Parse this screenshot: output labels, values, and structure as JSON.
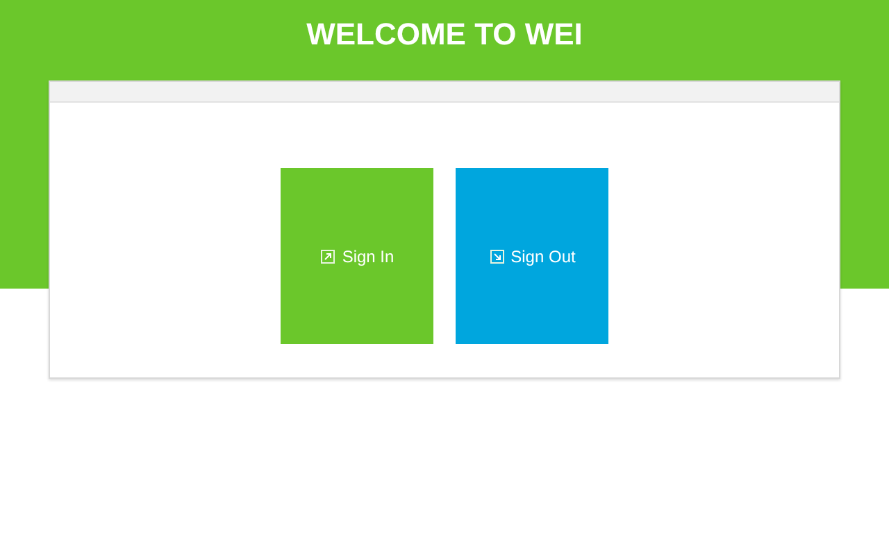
{
  "title": "WELCOME TO WEI",
  "actions": [
    {
      "label": "Sign In",
      "kind": "in"
    },
    {
      "label": "Sign Out",
      "kind": "out"
    }
  ]
}
